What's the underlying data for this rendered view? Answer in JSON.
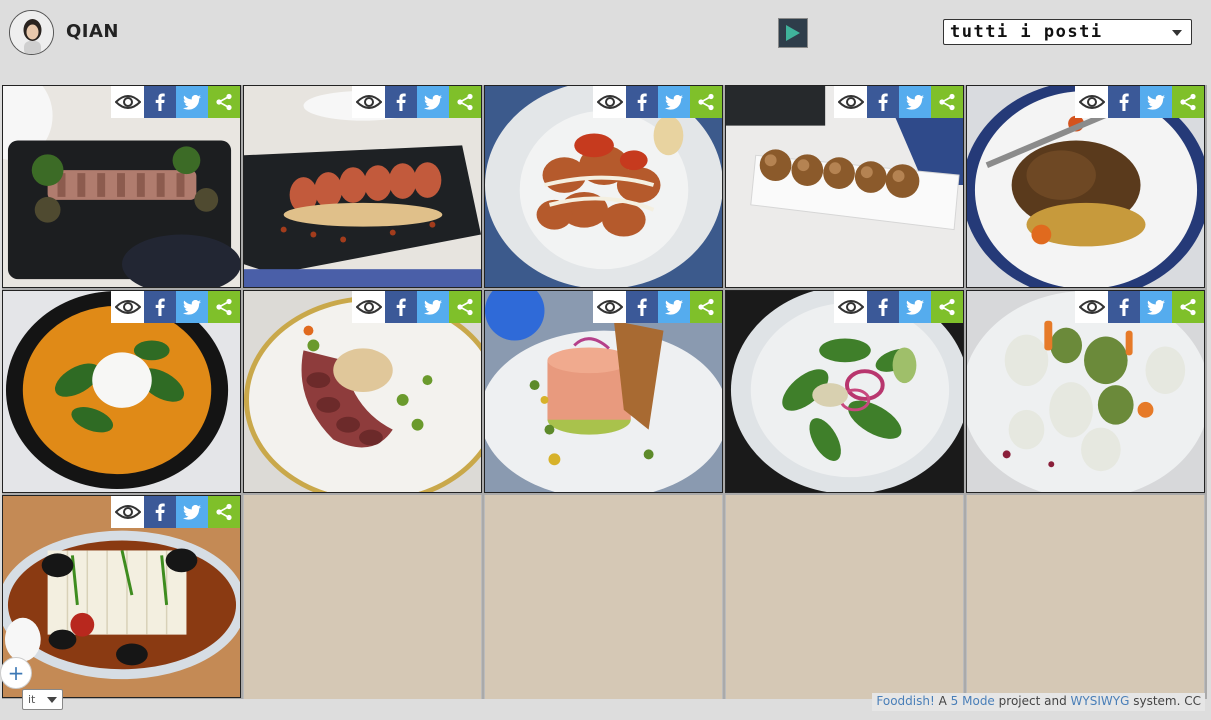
{
  "header": {
    "user_name": "QIAN",
    "place_filter": {
      "selected": "tutti i posti"
    }
  },
  "photos": [
    {
      "name": "seared-tuna-tataki-photo"
    },
    {
      "name": "grilled-octopus-photo"
    },
    {
      "name": "patatas-bravas-photo"
    },
    {
      "name": "croquettes-photo"
    },
    {
      "name": "braised-meat-photo"
    },
    {
      "name": "pumpkin-soup-burrata-photo"
    },
    {
      "name": "tuna-plate-photo"
    },
    {
      "name": "salmon-tartare-photo"
    },
    {
      "name": "green-salad-photo"
    },
    {
      "name": "cannelloni-vegetables-photo"
    },
    {
      "name": "tofu-mussels-photo"
    }
  ],
  "actions": {
    "icons": [
      "eye-icon",
      "facebook-icon",
      "twitter-icon",
      "share-icon"
    ]
  },
  "colors": {
    "facebook": "#3b5998",
    "twitter": "#55acee",
    "share": "#7fc02a",
    "empty_cell": "#d5c8b5",
    "play": "#2e3d4a",
    "play_triangle": "#3fb39b"
  },
  "add_button": {
    "label": "+"
  },
  "language": {
    "selected": "it"
  },
  "footer": {
    "app_link": "Fooddish!",
    "a_text": "A",
    "mode_link": "5 Mode",
    "project_text": "project and",
    "wysiwyg_link": "WYSIWYG",
    "system_text": "system. CC"
  }
}
